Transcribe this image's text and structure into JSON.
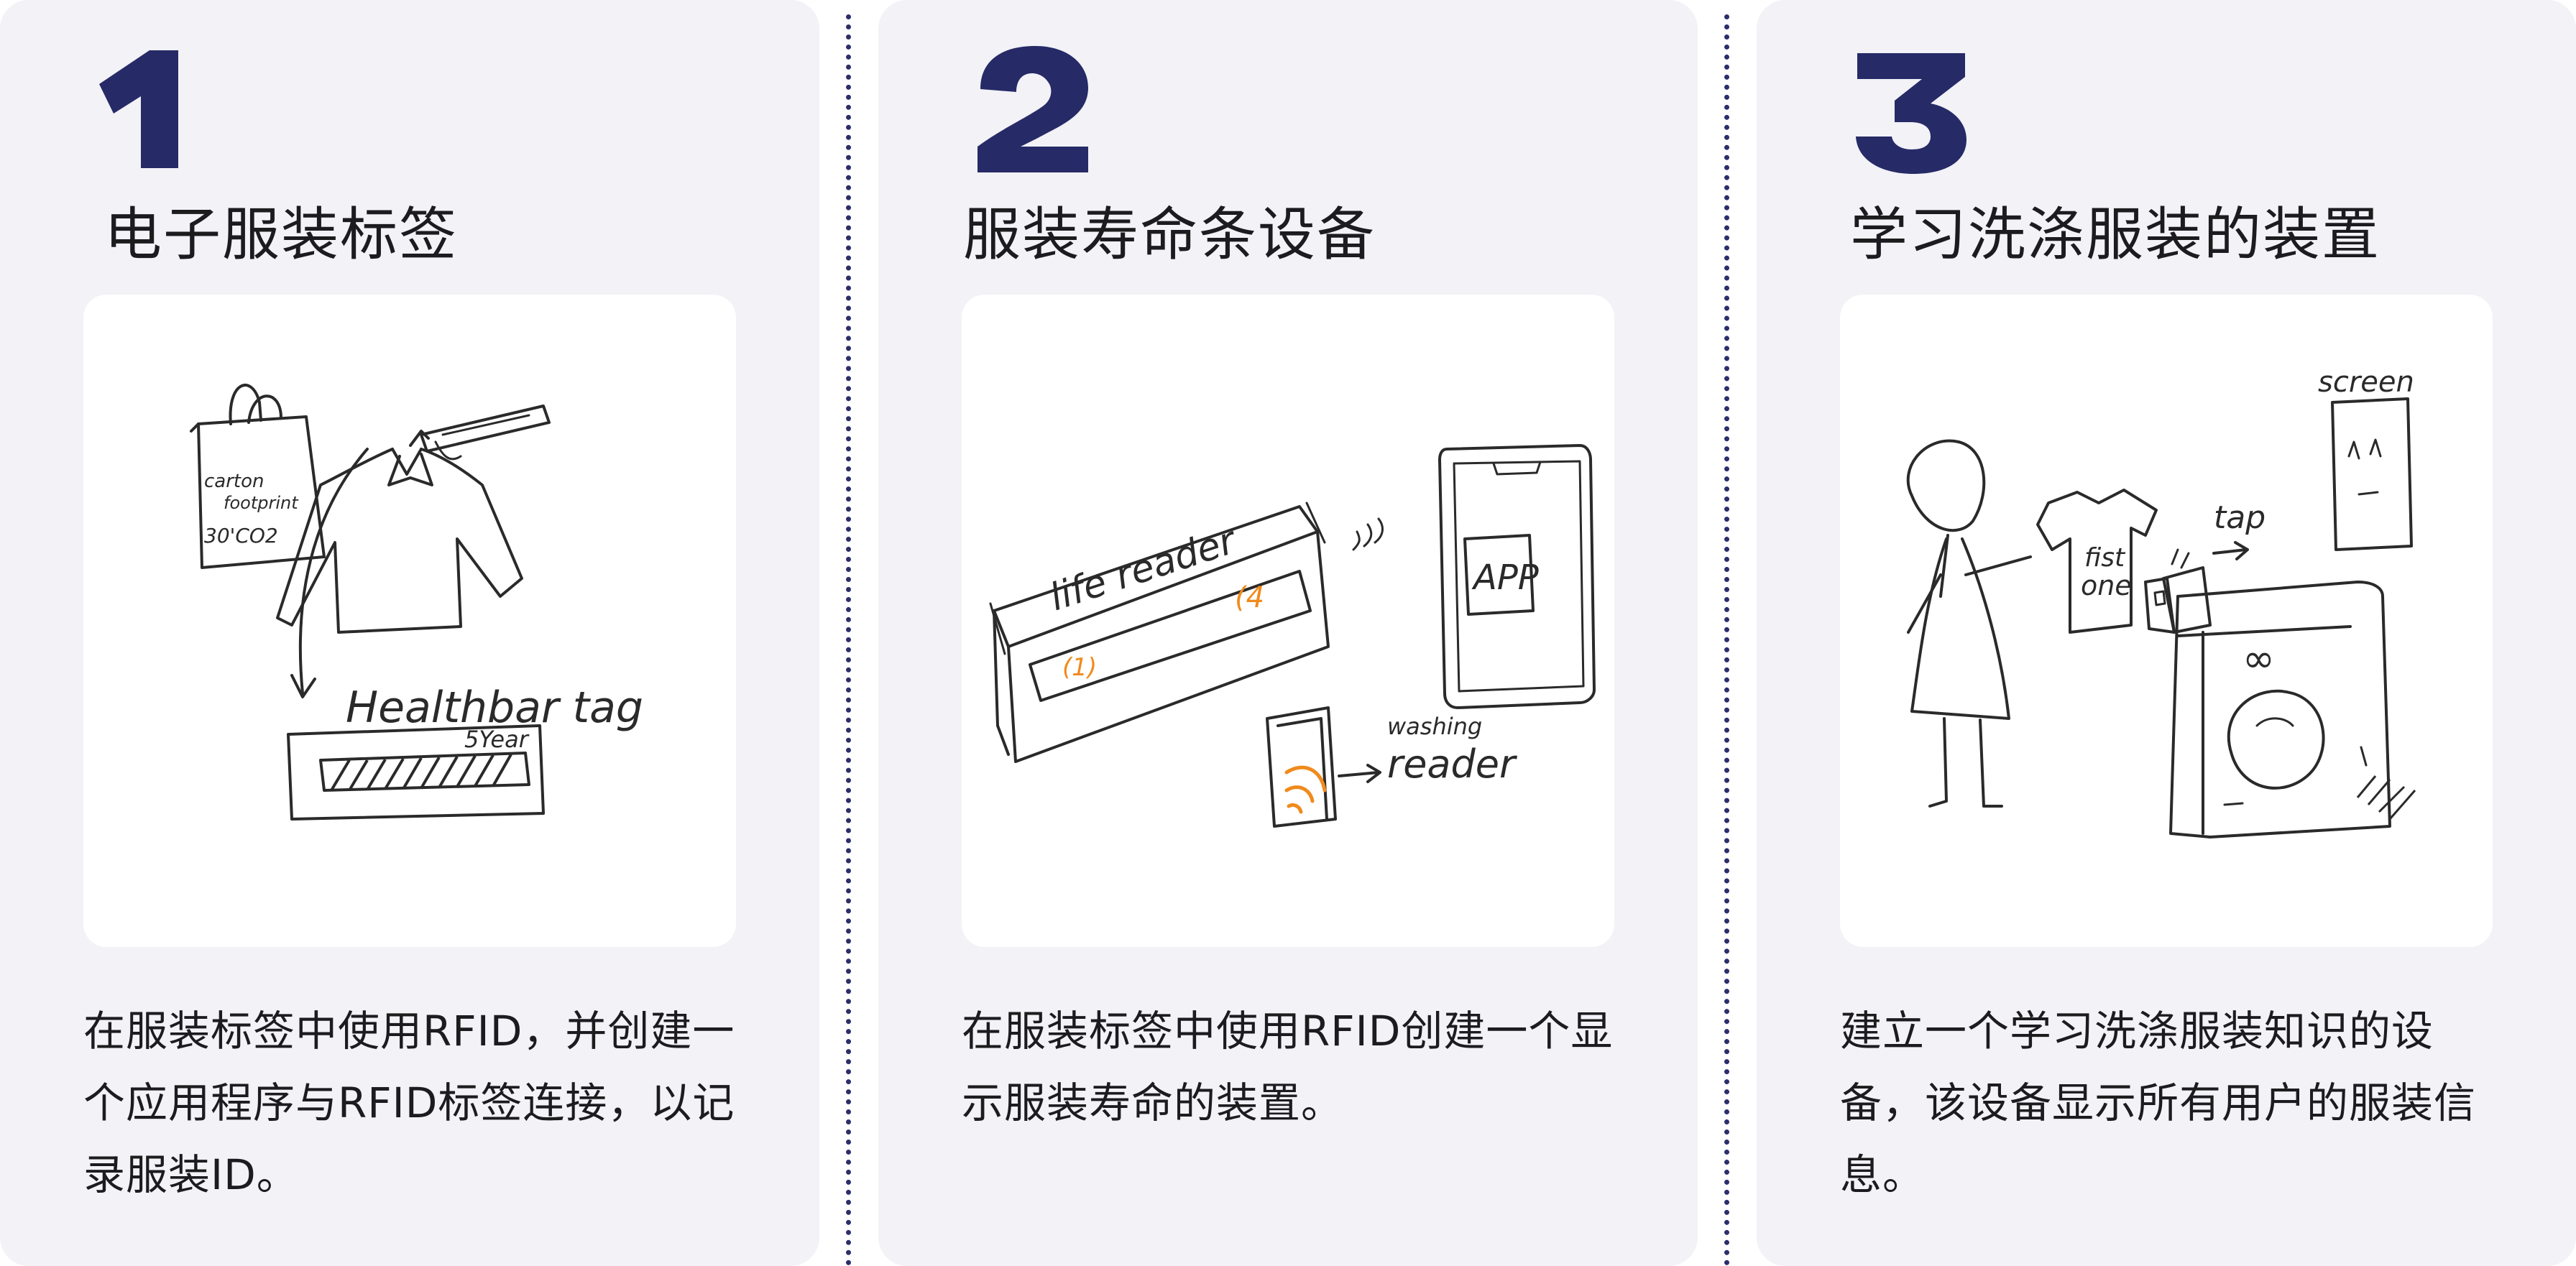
{
  "steps": [
    {
      "number": "1",
      "title": "电子服装标签",
      "description": "在服装标签中使用RFID，并创建一个应用程序与RFID标签连接，以记录服装ID。",
      "sketch_labels": {
        "bag_line1": "carton",
        "bag_line2": "footprint",
        "bag_line3": "30'CO2",
        "tag_label": "Healthbar tag",
        "bar_label": "5Year"
      }
    },
    {
      "number": "2",
      "title": "服装寿命条设备",
      "description": "在服装标签中使用RFID创建一个显示服装寿命的装置。",
      "sketch_labels": {
        "reader_label": "life reader",
        "screen_left": "(1)",
        "screen_right": "(4",
        "phone_label": "APP",
        "washing_label": "washing",
        "reader_label2": "reader"
      }
    },
    {
      "number": "3",
      "title": "学习洗涤服装的装置",
      "description": "建立一个学习洗涤服装知识的设备，该设备显示所有用户的服装信息。",
      "sketch_labels": {
        "screen_label": "screen",
        "tap_label": "tap",
        "shirt_line1": "fist",
        "shirt_line2": "one",
        "machine_label": "∞"
      }
    }
  ],
  "colors": {
    "number": "#262a66",
    "panel_bg": "#f2f2f7",
    "card_bg": "#ffffff",
    "divider": "#2b2e6b",
    "accent_orange": "#f08a1c"
  }
}
